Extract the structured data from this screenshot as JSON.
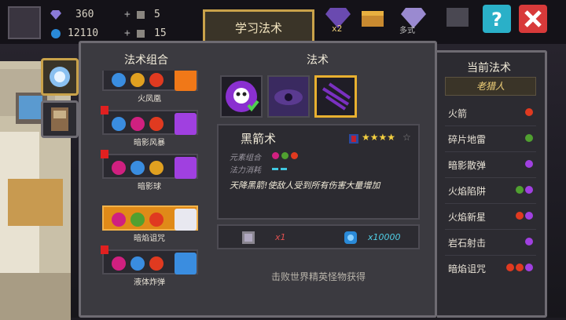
{
  "top": {
    "gems": "360",
    "coins": "12110",
    "potion_a": "5",
    "potion_b": "15",
    "tab_learn": "学习法术",
    "mini_badge": "x2",
    "mini_text": "多式"
  },
  "panel": {
    "combo_header": "法术组合",
    "spell_header": "法术",
    "current_header": "当前法术"
  },
  "combos": [
    {
      "name": "火凤凰",
      "colors": [
        "#3a8de0",
        "#e0a020",
        "#e03a20"
      ],
      "art": "#f07818",
      "dot": false,
      "selected": false
    },
    {
      "name": "暗影风暴",
      "colors": [
        "#3a8de0",
        "#d02080",
        "#e03a20"
      ],
      "art": "#a040e0",
      "dot": true,
      "selected": false
    },
    {
      "name": "暗影球",
      "colors": [
        "#d02080",
        "#3a8de0",
        "#e0a020"
      ],
      "art": "#a040e0",
      "dot": true,
      "selected": false
    },
    {
      "name": "暗焰诅咒",
      "colors": [
        "#d02080",
        "#50a030",
        "#e03a20"
      ],
      "art": "#e8e8f0",
      "dot": false,
      "selected": true
    },
    {
      "name": "液体炸弹",
      "colors": [
        "#d02080",
        "#3a8de0",
        "#e03a20"
      ],
      "art": "#3a8de0",
      "dot": true,
      "selected": false
    }
  ],
  "spell": {
    "name": "黑箭术",
    "stars": "★★★★",
    "stars_empty": "☆",
    "element_label": "元素组合",
    "mana_label": "法力消耗",
    "description": "天降黑箭!使敌人受到所有伤害大量增加",
    "cost_item_qty": "x1",
    "cost_coin_qty": "x10000",
    "source": "击败世界精英怪物获得"
  },
  "current": {
    "owner": "老猎人",
    "spells": [
      {
        "name": "火箭",
        "icons": [
          "#e03a20"
        ]
      },
      {
        "name": "碎片地雷",
        "icons": [
          "#50a030"
        ]
      },
      {
        "name": "暗影散弹",
        "icons": [
          "#a040e0"
        ]
      },
      {
        "name": "火焰陷阱",
        "icons": [
          "#50a030",
          "#a040e0"
        ]
      },
      {
        "name": "火焰新星",
        "icons": [
          "#e03a20",
          "#a040e0"
        ]
      },
      {
        "name": "岩石射击",
        "icons": [
          "#a040e0"
        ]
      },
      {
        "name": "暗焰诅咒",
        "icons": [
          "#e03a20",
          "#e03a20",
          "#a040e0"
        ]
      }
    ]
  }
}
